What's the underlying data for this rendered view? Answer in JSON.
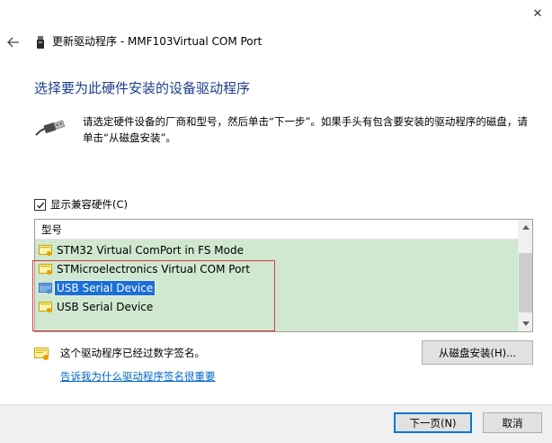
{
  "window": {
    "title": "更新驱动程序 - MMF103Virtual COM Port",
    "close_glyph": "✕",
    "back_glyph": "←"
  },
  "main": {
    "heading": "选择要为此硬件安装的设备驱动程序",
    "instruction": "请选定硬件设备的厂商和型号，然后单击“下一步”。如果手头有包含要安装的驱动程序的磁盘，请单击“从磁盘安装”。",
    "show_compatible": {
      "label": "显示兼容硬件(C)",
      "checked": true
    },
    "model_list": {
      "header": "型号",
      "items": [
        {
          "label": "STM32 Virtual ComPort in FS Mode",
          "selected": false
        },
        {
          "label": "STMicroelectronics Virtual COM Port",
          "selected": false
        },
        {
          "label": "USB Serial Device",
          "selected": true
        },
        {
          "label": "USB Serial Device",
          "selected": false
        }
      ]
    },
    "signature_text": "这个驱动程序已经过数字签名。",
    "signature_link": "告诉我为什么驱动程序签名很重要",
    "have_disk_button": "从磁盘安装(H)..."
  },
  "footer": {
    "next_button": "下一页(N)",
    "cancel_button": "取消"
  },
  "colors": {
    "heading": "#1e3e8c",
    "list_background": "#cfe8cf",
    "selection": "#1b6fd6",
    "annotation_frame": "#d83b3b",
    "link": "#0066cc"
  }
}
